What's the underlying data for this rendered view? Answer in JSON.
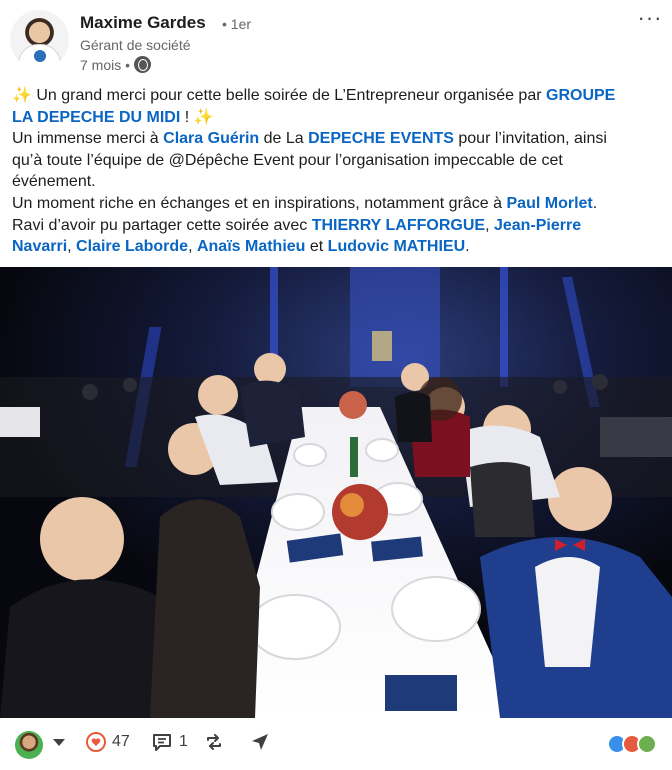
{
  "post": {
    "author": {
      "name": "Maxime Gardes",
      "degree": "• 1er",
      "headline": "Gérant de société",
      "time": "7 mois •",
      "visibility_icon": "globe-icon"
    },
    "more_label": "···",
    "text": {
      "p1_a": " Un grand merci pour cette belle soirée de L’Entrepreneur organisée par ",
      "p1_m1": "GROUPE",
      "p1_m2": "LA DEPECHE DU MIDI",
      "p1_b": " ! ",
      "p2_a": "Un immense merci à ",
      "p2_m1": "Clara Guérin",
      "p2_b": " de La ",
      "p2_m2": "DEPECHE EVENTS",
      "p2_c": " pour l’invitation, ainsi",
      "p3": "qu’à toute l’équipe de @Dépêche Event pour l’organisation impeccable de cet",
      "p4": "événement.",
      "p5_a": "Un moment riche en échanges et en inspirations, notamment grâce à ",
      "p5_m1": "Paul Morlet",
      "p5_b": ".",
      "p6_a": "Ravi d’avoir pu partager cette soirée avec ",
      "p6_m1": "THIERRY LAFFORGUE",
      "p6_b": ", ",
      "p6_m2": "Jean-Pierre",
      "p7_m1": "Navarri",
      "p7_a": ", ",
      "p7_m2": "Claire Laborde",
      "p7_b": ", ",
      "p7_m3": "Anaïs Mathieu",
      "p7_c": " et ",
      "p7_m4": "Ludovic MATHIEU",
      "p7_d": "."
    },
    "sparkle": "✨"
  },
  "actions": {
    "likes": "47",
    "comments": "1",
    "repost_icon": "repost-icon",
    "send_icon": "send-icon"
  },
  "colors": {
    "link": "#0a66c2",
    "heart": "#e85a3c",
    "celebrate": "#6dae4f",
    "support": "#378fe9"
  }
}
